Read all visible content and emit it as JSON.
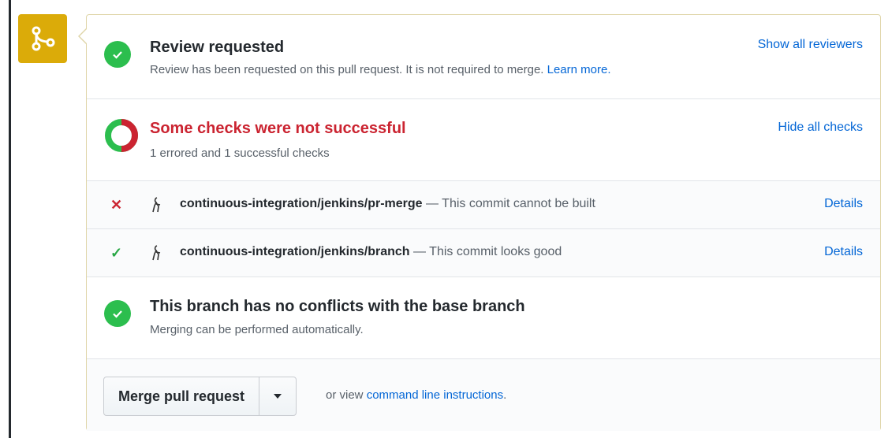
{
  "review": {
    "title": "Review requested",
    "description": "Review has been requested on this pull request. It is not required to merge.",
    "learn_more": "Learn more.",
    "action": "Show all reviewers"
  },
  "checks": {
    "title": "Some checks were not successful",
    "summary": "1 errored and 1 successful checks",
    "action": "Hide all checks",
    "items": [
      {
        "status": "error",
        "mark": "✕",
        "context": "continuous-integration/jenkins/pr-merge",
        "description": " — This commit cannot be built",
        "details": "Details"
      },
      {
        "status": "success",
        "mark": "✓",
        "context": "continuous-integration/jenkins/branch",
        "description": " — This commit looks good",
        "details": "Details"
      }
    ]
  },
  "conflicts": {
    "title": "This branch has no conflicts with the base branch",
    "description": "Merging can be performed automatically."
  },
  "merge": {
    "button_label": "Merge pull request",
    "hint_prefix": "or view",
    "hint_link": "command line instructions",
    "hint_suffix": "."
  },
  "colors": {
    "success": "#2cbe4e",
    "error": "#cb2431",
    "link": "#0366d6",
    "merge_icon_bg": "#dbab09"
  },
  "icons": {
    "timeline": "git-merge-icon",
    "status_ok": "check-circle-icon",
    "status_partial": "partial-ring-icon",
    "avatar": "jenkins-avatar-icon",
    "caret": "triangle-down-icon"
  }
}
